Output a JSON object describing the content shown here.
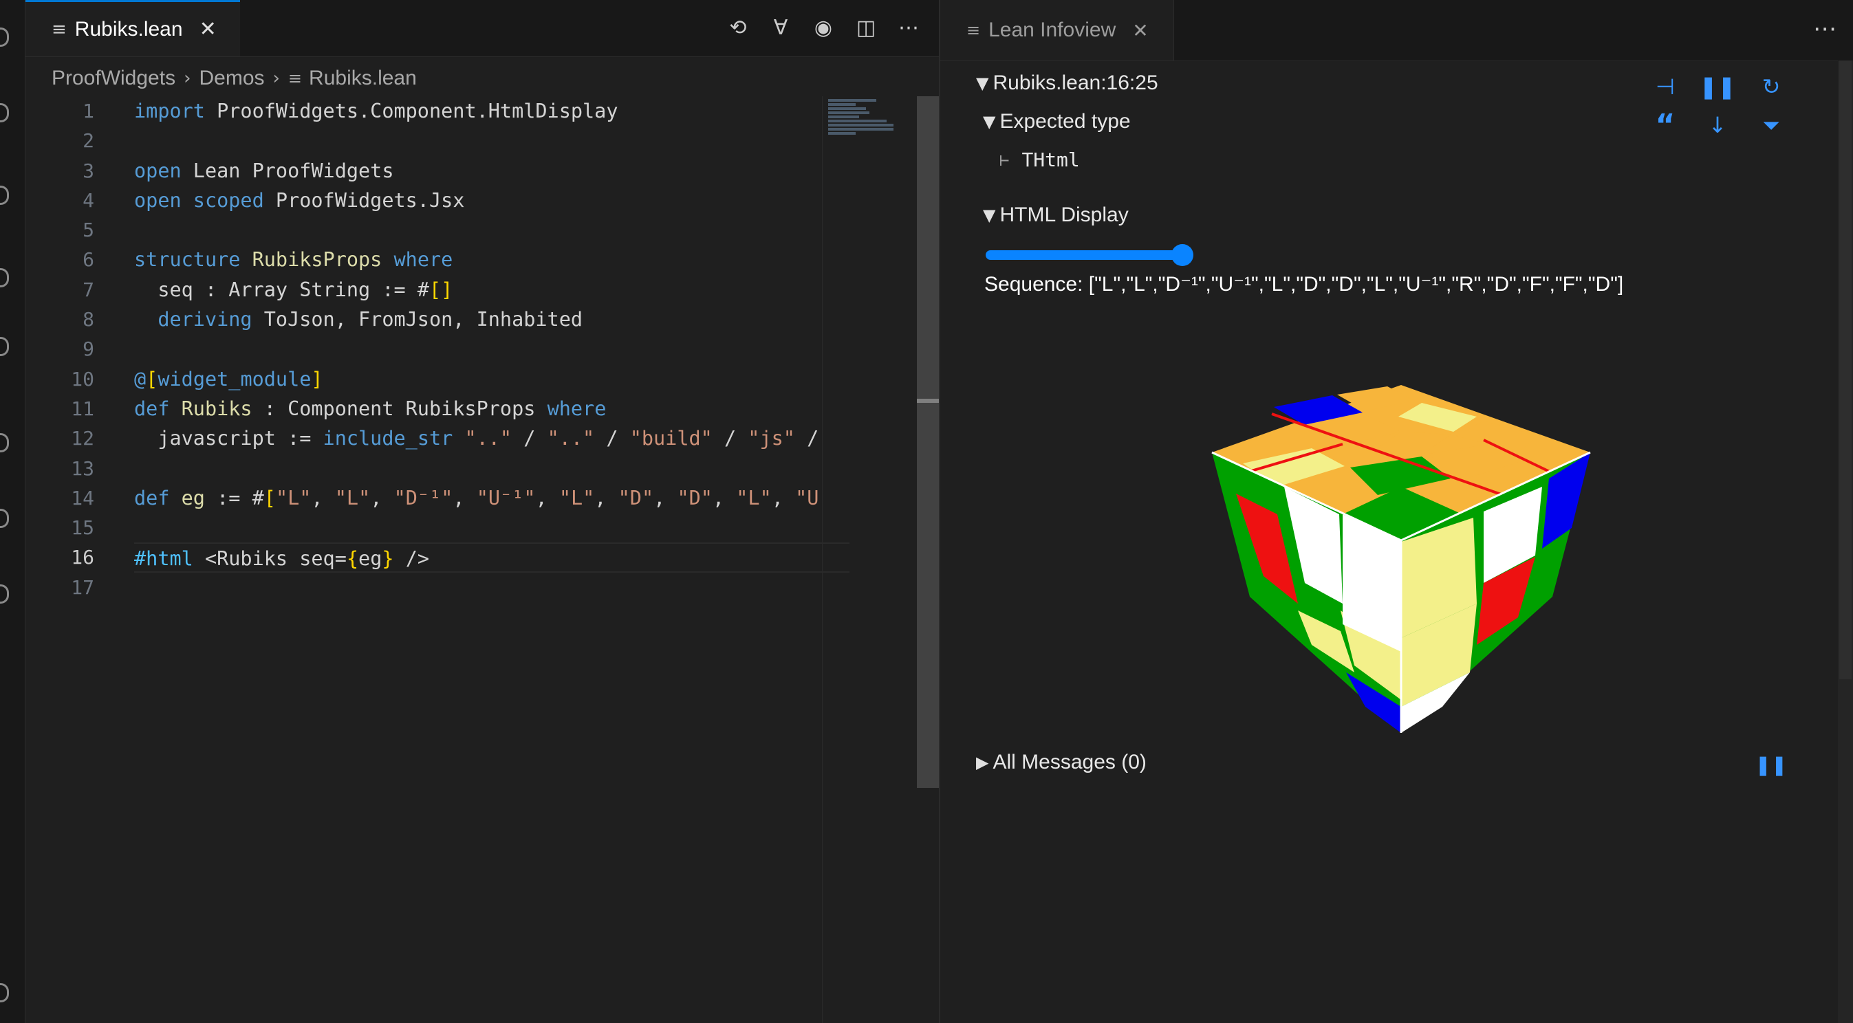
{
  "editor": {
    "tab": {
      "name": "Rubiks.lean"
    },
    "breadcrumb": [
      "ProofWidgets",
      "Demos",
      "Rubiks.lean"
    ],
    "line_numbers": [
      "1",
      "2",
      "3",
      "4",
      "5",
      "6",
      "7",
      "8",
      "9",
      "10",
      "11",
      "12",
      "13",
      "14",
      "15",
      "16",
      "17"
    ],
    "current_line": "16",
    "code": {
      "l1a": "import",
      "l1b": " ProofWidgets.Component.HtmlDisplay",
      "l3a": "open",
      "l3b": " Lean ProofWidgets",
      "l4a": "open",
      "l4b": " scoped",
      "l4c": " ProofWidgets.Jsx",
      "l6a": "structure",
      "l6b": " RubiksProps",
      "l6c": " where",
      "l7a": "  seq : Array String := #",
      "l7b": "[]",
      "l8a": "  deriving",
      "l8b": " ToJson, FromJson, Inhabited",
      "l10a": "@",
      "l10b": "[",
      "l10c": "widget_module",
      "l10d": "]",
      "l11a": "def",
      "l11b": " Rubiks",
      "l11c": " : Component RubiksProps ",
      "l11d": "where",
      "l12a": "  javascript := ",
      "l12b": "include_str",
      "l12c": " \"..\"",
      "l12d": " / ",
      "l12e": "\"..\"",
      "l12f": " / ",
      "l12g": "\"build\"",
      "l12h": " / ",
      "l12i": "\"js\"",
      "l12j": " /",
      "l14a": "def",
      "l14b": " eg",
      "l14c": " := #",
      "l14d": "[",
      "l14e": "\"L\"",
      "l14f": ", ",
      "l14g": "\"L\"",
      "l14h": ", ",
      "l14i": "\"D⁻¹\"",
      "l14j": ", ",
      "l14k": "\"U⁻¹\"",
      "l14l": ", ",
      "l14m": "\"L\"",
      "l14n": ", ",
      "l14o": "\"D\"",
      "l14p": ", ",
      "l14q": "\"D\"",
      "l14r": ", ",
      "l14s": "\"L\"",
      "l14t": ", ",
      "l14u": "\"U",
      "l16a": "#html",
      "l16b": " <Rubiks seq=",
      "l16c": "{",
      "l16d": "eg",
      "l16e": "}",
      "l16f": " />"
    }
  },
  "infoview": {
    "tab": {
      "name": "Lean Infoview"
    },
    "location": "Rubiks.lean:16:25",
    "expected_type_label": "Expected type",
    "turnstile": "⊢",
    "expected_type_value": "THtml",
    "html_display_label": "HTML Display",
    "slider_level": 1.0,
    "sequence_text": "Sequence: [\"L\",\"L\",\"D⁻¹\",\"U⁻¹\",\"L\",\"D\",\"D\",\"L\",\"U⁻¹\",\"R\",\"D\",\"F\",\"F\",\"D\"]",
    "all_messages": "All Messages (0)"
  },
  "colors": {
    "accent": "#0078d4",
    "blue_icon": "#3794ff",
    "cube_green": "#00a000",
    "cube_yellow": "#f3f08a",
    "cube_orange": "#f7b53b",
    "cube_blue": "#0000ee",
    "cube_red": "#ee1111"
  }
}
